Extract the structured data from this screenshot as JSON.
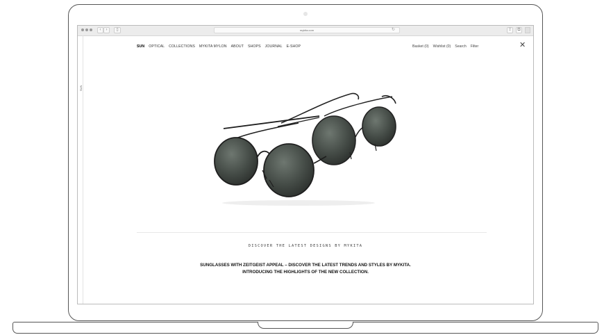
{
  "browser": {
    "url": "mykita.com",
    "reload_glyph": "↻",
    "back_glyph": "‹",
    "forward_glyph": "›",
    "sidebar_glyph": "▯",
    "share_glyph": "⇪",
    "tabs_glyph": "⧉"
  },
  "page": {
    "side_tab": "SUN",
    "nav": [
      "SUN",
      "OPTICAL",
      "COLLECTIONS",
      "MYKITA MYLON",
      "ABOUT",
      "SHOPS",
      "JOURNAL",
      "E-SHOP"
    ],
    "nav_active": "SUN",
    "nav_right": [
      "Basket (0)",
      "Wishlist (0)",
      "Search",
      "Filter"
    ],
    "close_glyph": "✕",
    "discover": "DISCOVER THE LATEST DESIGNS BY MYKITA",
    "headline_line1": "SUNGLASSES WITH ZEITGEIST APPEAL – DISCOVER THE LATEST TRENDS AND STYLES BY MYKITA.",
    "headline_line2": "INTRODUCING THE HIGHLIGHTS OF THE NEW COLLECTION."
  }
}
